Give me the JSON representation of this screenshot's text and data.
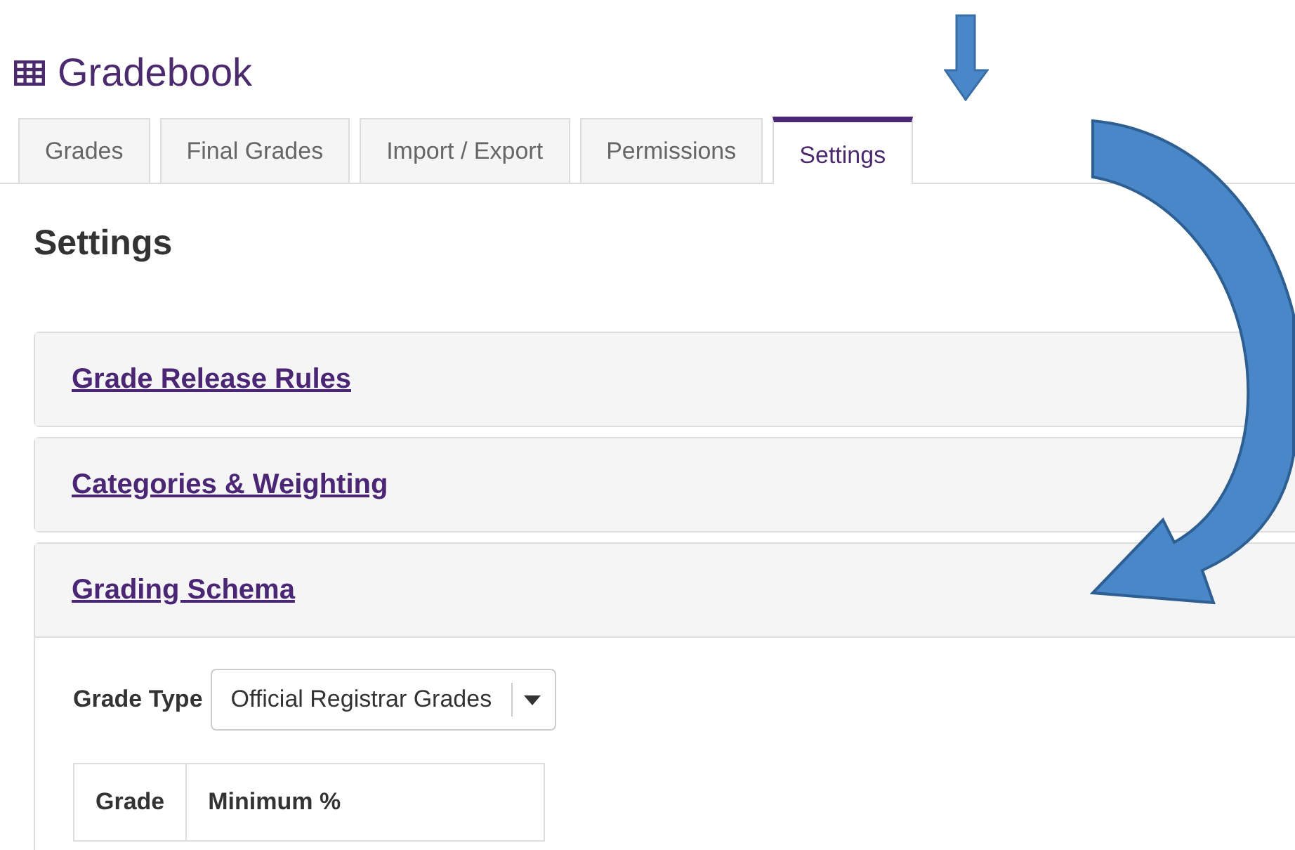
{
  "title": "Gradebook",
  "tabs": [
    {
      "label": "Grades",
      "selected": false
    },
    {
      "label": "Final Grades",
      "selected": false
    },
    {
      "label": "Import / Export",
      "selected": false
    },
    {
      "label": "Permissions",
      "selected": false
    },
    {
      "label": "Settings",
      "selected": true
    }
  ],
  "heading": "Settings",
  "sections": [
    {
      "title": "Grade Release Rules",
      "expanded": false
    },
    {
      "title": "Categories & Weighting",
      "expanded": false
    },
    {
      "title": "Grading Schema",
      "expanded": true,
      "grade_type": {
        "label": "Grade Type",
        "value": "Official Registrar Grades"
      },
      "table": {
        "columns": [
          "Grade",
          "Minimum %"
        ]
      }
    }
  ]
}
